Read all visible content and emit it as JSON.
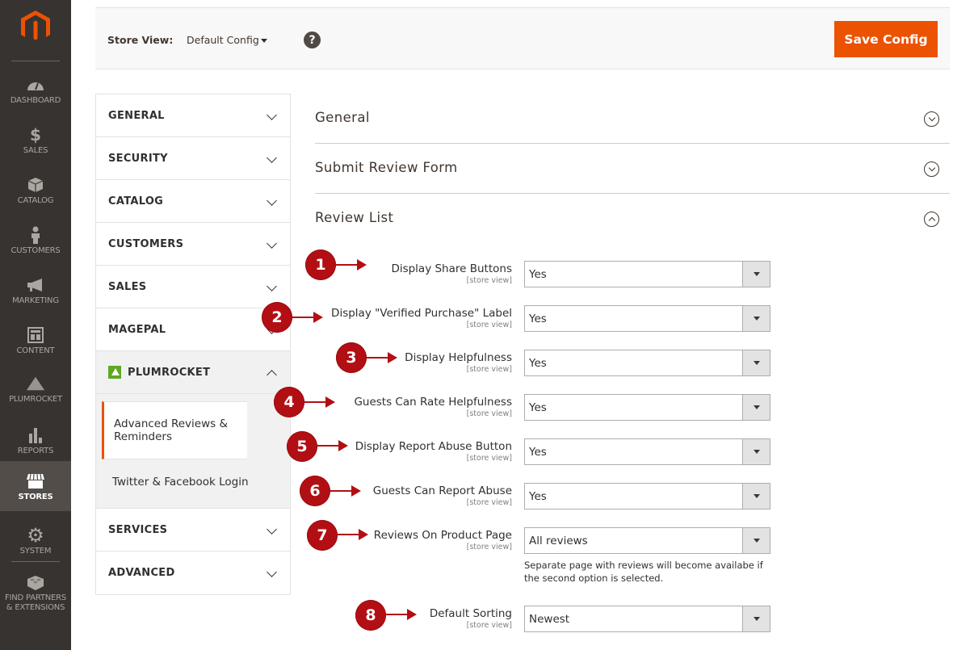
{
  "admin_nav": {
    "logo": "magento-logo",
    "items": [
      {
        "label": "DASHBOARD",
        "icon": "dashboard-gauge-icon"
      },
      {
        "label": "SALES",
        "icon": "dollar-icon"
      },
      {
        "label": "CATALOG",
        "icon": "box-icon"
      },
      {
        "label": "CUSTOMERS",
        "icon": "person-icon"
      },
      {
        "label": "MARKETING",
        "icon": "megaphone-icon"
      },
      {
        "label": "CONTENT",
        "icon": "layout-icon"
      },
      {
        "label": "PLUMROCKET",
        "icon": "plumrocket-icon"
      },
      {
        "label": "REPORTS",
        "icon": "bar-chart-icon"
      },
      {
        "label": "STORES",
        "icon": "storefront-icon",
        "active": true
      },
      {
        "label": "SYSTEM",
        "icon": "gear-icon"
      },
      {
        "label": "FIND PARTNERS & EXTENSIONS",
        "icon": "lego-brick-icon"
      }
    ]
  },
  "actions_bar": {
    "store_view_label": "Store View:",
    "store_view_value": "Default Config",
    "help_glyph": "?",
    "save_label": "Save Config",
    "accent": "#eb5202"
  },
  "config_tabs": {
    "items": [
      {
        "label": "GENERAL"
      },
      {
        "label": "SECURITY"
      },
      {
        "label": "CATALOG"
      },
      {
        "label": "CUSTOMERS"
      },
      {
        "label": "SALES"
      },
      {
        "label": "MAGEPAL"
      },
      {
        "label": "PLUMROCKET",
        "open": true
      },
      {
        "label": "SERVICES"
      },
      {
        "label": "ADVANCED"
      }
    ],
    "plumrocket_children": [
      {
        "label": "Advanced Reviews & Reminders",
        "active": true
      },
      {
        "label": "Twitter & Facebook Login"
      }
    ]
  },
  "sections": [
    {
      "title": "General",
      "open": false
    },
    {
      "title": "Submit Review Form",
      "open": false
    },
    {
      "title": "Review List",
      "open": true
    }
  ],
  "review_list_fields": [
    {
      "marker": "1",
      "label": "Display Share Buttons",
      "scope": "[store view]",
      "value": "Yes"
    },
    {
      "marker": "2",
      "label": "Display \"Verified Purchase\" Label",
      "scope": "[store view]",
      "value": "Yes"
    },
    {
      "marker": "3",
      "label": "Display Helpfulness",
      "scope": "[store view]",
      "value": "Yes"
    },
    {
      "marker": "4",
      "label": "Guests Can Rate Helpfulness",
      "scope": "[store view]",
      "value": "Yes"
    },
    {
      "marker": "5",
      "label": "Display Report Abuse Button",
      "scope": "[store view]",
      "value": "Yes"
    },
    {
      "marker": "6",
      "label": "Guests Can Report Abuse",
      "scope": "[store view]",
      "value": "Yes"
    },
    {
      "marker": "7",
      "label": "Reviews On Product Page",
      "scope": "[store view]",
      "value": "All reviews",
      "note": "Separate page with reviews will become availabe if the second option is selected."
    },
    {
      "marker": "8",
      "label": "Default Sorting",
      "scope": "[store view]",
      "value": "Newest"
    }
  ],
  "colors": {
    "nav_bg": "#373330",
    "nav_active": "#524d49",
    "marker": "#b20f14",
    "plumrocket_green": "#5fa823"
  }
}
